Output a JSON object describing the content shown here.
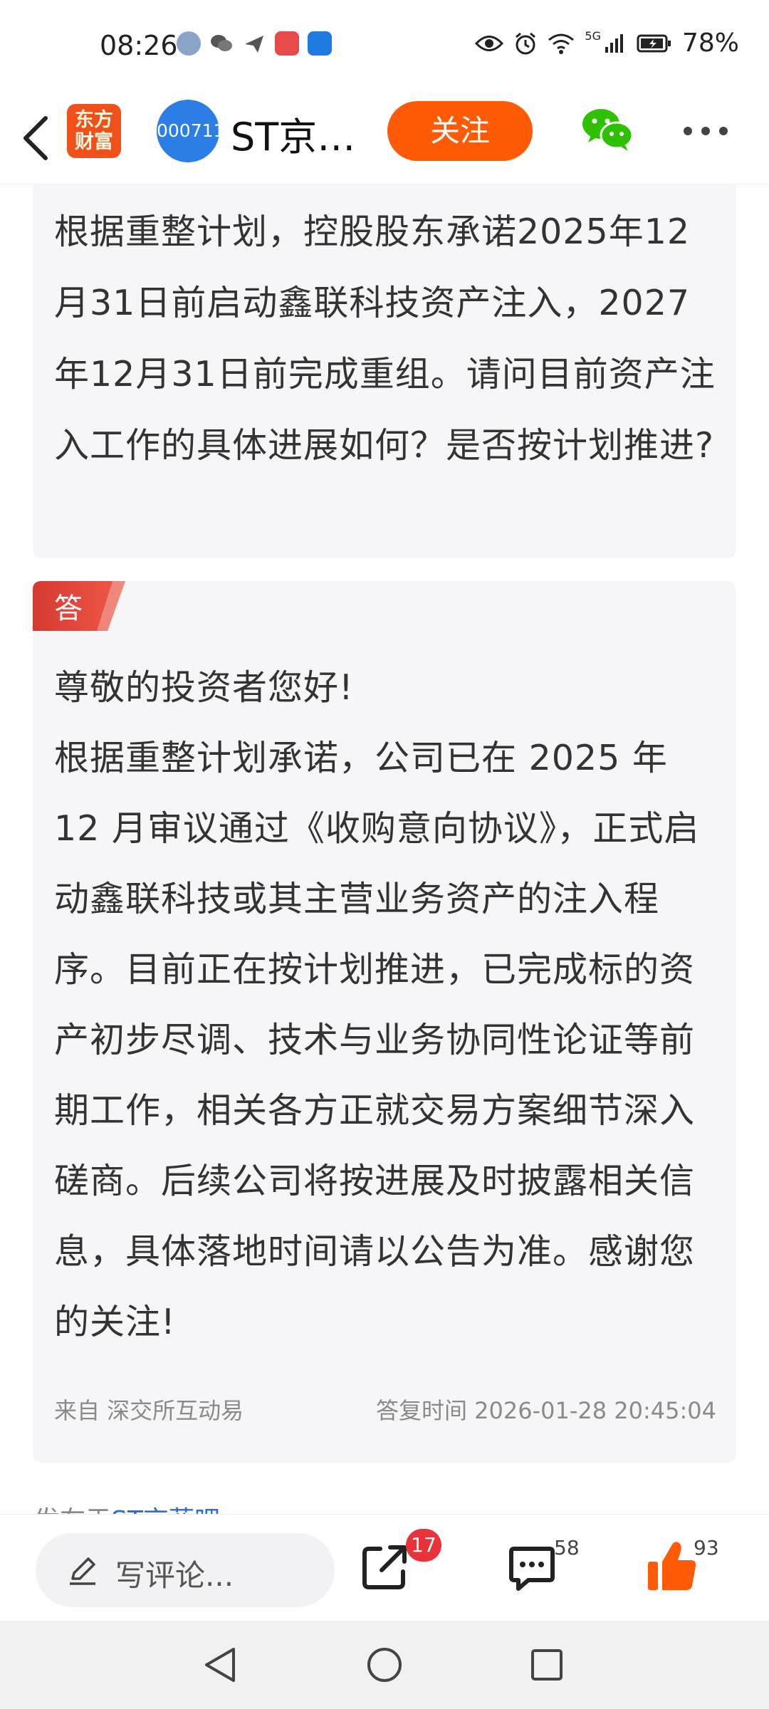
{
  "status_bar": {
    "time": "08:26",
    "network": "5G",
    "battery": "78%"
  },
  "header": {
    "logo_text": "东方财富",
    "stock_code": "000711",
    "stock_name": "ST京…",
    "follow_label": "关注"
  },
  "question": {
    "text": "根据重整计划，控股股东承诺2025年12月31日前启动鑫联科技资产注入，2027年12月31日前完成重组。请问目前资产注入工作的具体进展如何？是否按计划推进?"
  },
  "answer": {
    "badge": "答",
    "greeting": "尊敬的投资者您好!",
    "body": "根据重整计划承诺，公司已在 2025 年 12 月审议通过《收购意向协议》，正式启动鑫联科技或其主营业务资产的注入程序。目前正在按计划推进，已完成标的资产初步尽调、技术与业务协同性论证等前期工作，相关各方正就交易方案细节深入磋商。后续公司将按进展及时披露相关信息，具体落地时间请以公告为准。感谢您的关注!",
    "source": "来自 深交所互动易",
    "reply_time": "答复时间 2026-01-28 20:45:04"
  },
  "posted_in": {
    "prefix": "发布于",
    "forum": "ST京蓝吧"
  },
  "toolbar": {
    "comment_placeholder": "写评论...",
    "share_count": "17",
    "comment_count": "58",
    "like_count": "93"
  },
  "colors": {
    "accent": "#ff5a06",
    "badge_red": "#e8333b",
    "card_bg": "#f6f6f9",
    "link": "#2b6fd0"
  },
  "icons": [
    "back-icon",
    "wechat-icon",
    "more-icon",
    "pen-icon",
    "share-icon",
    "comment-icon",
    "like-icon",
    "nav-back-icon",
    "nav-home-icon",
    "nav-recent-icon"
  ]
}
